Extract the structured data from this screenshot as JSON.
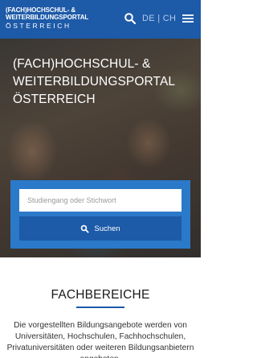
{
  "header": {
    "logo_line1": "(FACH)HOCHSCHUL- &",
    "logo_line2": "WEITERBILDUNGSPORTAL",
    "logo_line3": "ÖSTERREICH",
    "lang_de": "DE",
    "lang_separator": "|",
    "lang_ch": "CH",
    "search_icon": "search-icon",
    "menu_icon": "hamburger-menu-icon"
  },
  "hero": {
    "title": "(FACH)HOCHSCHUL- & WEITERBILDUNGSPORTAL ÖSTERREICH",
    "search_placeholder": "Studiengang oder Stichwort",
    "search_button_label": "Suchen"
  },
  "section": {
    "title": "FACHBEREICHE",
    "text": "Die vorgestellten Bildungsangebote werden von Universitäten, Hochschulen, Fachhochschulen, Privatuniversitäten oder weiteren Bildungsanbietern angeboten."
  },
  "colors": {
    "header_bg": "#1d5aa8",
    "search_panel": "#2b79c9",
    "button": "#1d5aa8",
    "accent_rule": "#1d5aa8"
  }
}
